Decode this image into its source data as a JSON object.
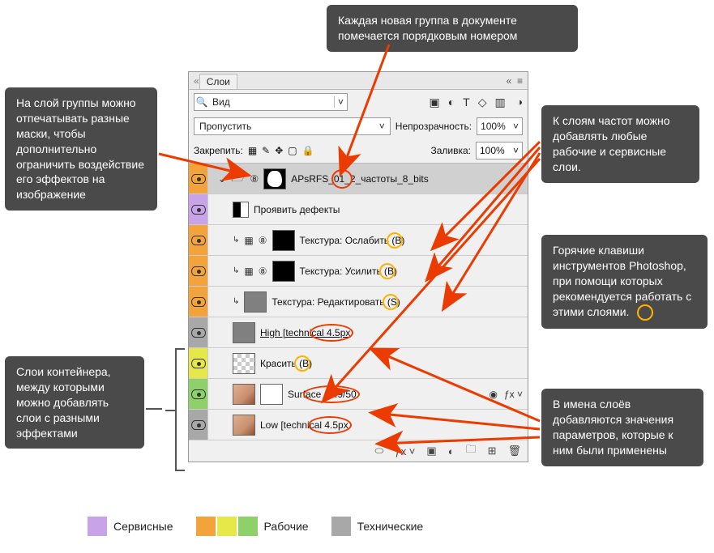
{
  "callouts": {
    "top": "Каждая новая группа в документе помечается порядковым номером",
    "left1": "На слой группы можно отпечатывать разные маски, чтобы дополнительно ограничить воздействие его эффектов на изображение",
    "left2": "Слои контейнера, между которыми можно добавлять слои с разными эффектами",
    "right1": "К слоям частот можно добавлять любые рабочие и сервисные слои.",
    "right2": "Горячие клавиши инструментов Photoshop, при помощи которых рекомендуется работать с этими слоями.",
    "right3": "В имена слоёв добавляются значения параметров, которые к ним были применены"
  },
  "panel": {
    "tab": "Слои",
    "search_mode": "Вид",
    "blend_mode": "Пропустить",
    "opacity_label": "Непрозрачность:",
    "opacity_value": "100%",
    "lock_label": "Закрепить:",
    "fill_label": "Заливка:",
    "fill_value": "100%"
  },
  "layers": [
    {
      "color": "#f2a33c",
      "indent": 0,
      "group": true,
      "name": "APsRFS_01_2_частоты_8_bits",
      "thumbs": [],
      "selected": true
    },
    {
      "color": "#c9a3e8",
      "indent": 1,
      "clip": false,
      "fx": false,
      "thumbs": [
        "half"
      ],
      "name": "Проявить дефекты"
    },
    {
      "color": "#f2a33c",
      "indent": 1,
      "clip": true,
      "fx": true,
      "thumbs": [
        "black"
      ],
      "name": "Текстура: Ослабить (B)",
      "hl_letter": true
    },
    {
      "color": "#f2a33c",
      "indent": 1,
      "clip": true,
      "fx": true,
      "thumbs": [
        "black"
      ],
      "name": "Текстура: Усилить (B)",
      "hl_letter": true
    },
    {
      "color": "#f2a33c",
      "indent": 1,
      "clip": true,
      "fx": false,
      "thumbs": [
        "gray"
      ],
      "name": "Текстура: Редактировать (S)",
      "hl_letter": true
    },
    {
      "color": "#a8a8a8",
      "indent": 1,
      "clip": false,
      "fx": false,
      "thumbs": [
        "gray"
      ],
      "name": "High [technical  4.5px",
      "underline": true,
      "oval": "4.5px"
    },
    {
      "color": "#e6e84a",
      "indent": 1,
      "clip": false,
      "fx": false,
      "thumbs": [
        "chk"
      ],
      "name": "Красить (B)",
      "hl_letter": true
    },
    {
      "color": "#8ed06a",
      "indent": 1,
      "clip": false,
      "fx": false,
      "thumbs": [
        "photo",
        "mask-white"
      ],
      "name": "Surface 17.9/50",
      "extras": true,
      "oval": "17.9/50"
    },
    {
      "color": "#a8a8a8",
      "indent": 1,
      "clip": false,
      "fx": false,
      "thumbs": [
        "photo"
      ],
      "name": "Low [technical  4.5px",
      "oval": "4.5px"
    }
  ],
  "legend": {
    "service": "Сервисные",
    "work": "Рабочие",
    "tech": "Технические"
  }
}
